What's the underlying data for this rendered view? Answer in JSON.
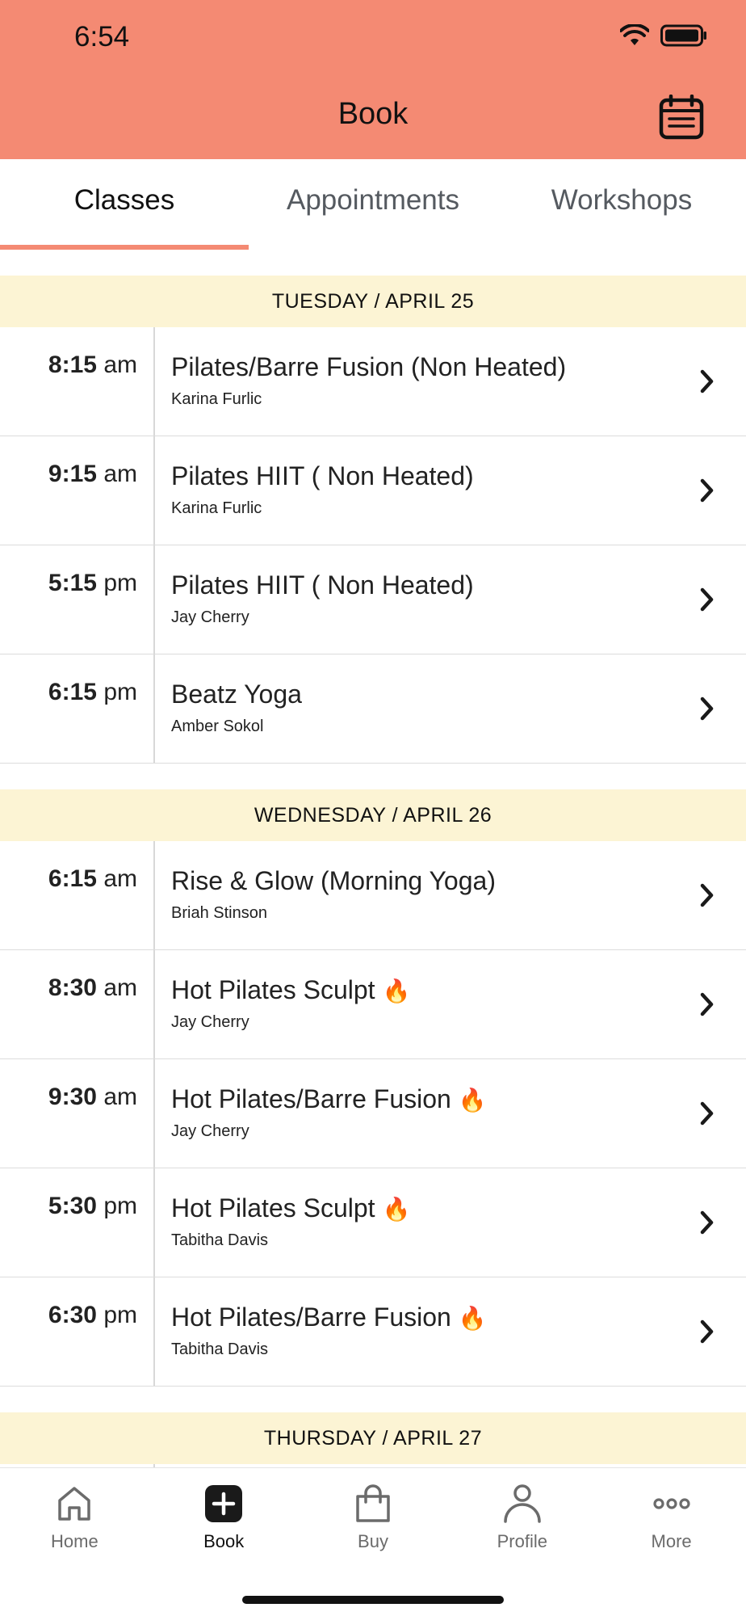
{
  "status_bar": {
    "time": "6:54"
  },
  "header": {
    "title": "Book",
    "calendar_icon": "calendar-icon",
    "background": "#f48a73"
  },
  "tabs": [
    {
      "label": "Classes",
      "active": true
    },
    {
      "label": "Appointments",
      "active": false
    },
    {
      "label": "Workshops",
      "active": false
    }
  ],
  "days": [
    {
      "label": "TUESDAY / APRIL 25",
      "classes": [
        {
          "time": "8:15",
          "ampm": "am",
          "name": "Pilates/Barre Fusion (Non Heated)",
          "instructor": "Karina Furlic",
          "heated": false
        },
        {
          "time": "9:15",
          "ampm": "am",
          "name": "Pilates HIIT ( Non Heated)",
          "instructor": "Karina Furlic",
          "heated": false
        },
        {
          "time": "5:15",
          "ampm": "pm",
          "name": "Pilates HIIT ( Non Heated)",
          "instructor": "Jay Cherry",
          "heated": false
        },
        {
          "time": "6:15",
          "ampm": "pm",
          "name": "Beatz Yoga",
          "instructor": "Amber Sokol",
          "heated": false
        }
      ]
    },
    {
      "label": "WEDNESDAY / APRIL 26",
      "classes": [
        {
          "time": "6:15",
          "ampm": "am",
          "name": "Rise & Glow (Morning Yoga)",
          "instructor": "Briah Stinson",
          "heated": false
        },
        {
          "time": "8:30",
          "ampm": "am",
          "name": "Hot Pilates Sculpt",
          "instructor": "Jay Cherry",
          "heated": true
        },
        {
          "time": "9:30",
          "ampm": "am",
          "name": "Hot Pilates/Barre Fusion",
          "instructor": "Jay Cherry",
          "heated": true
        },
        {
          "time": "5:30",
          "ampm": "pm",
          "name": "Hot Pilates Sculpt",
          "instructor": "Tabitha Davis",
          "heated": true
        },
        {
          "time": "6:30",
          "ampm": "pm",
          "name": "Hot Pilates/Barre Fusion",
          "instructor": "Tabitha Davis",
          "heated": true
        }
      ]
    },
    {
      "label": "THURSDAY / APRIL 27",
      "classes": []
    }
  ],
  "flame_glyph": "🔥",
  "bottom_nav": [
    {
      "label": "Home",
      "icon": "home-icon",
      "active": false
    },
    {
      "label": "Book",
      "icon": "plus-square-icon",
      "active": true
    },
    {
      "label": "Buy",
      "icon": "shopping-bag-icon",
      "active": false
    },
    {
      "label": "Profile",
      "icon": "person-icon",
      "active": false
    },
    {
      "label": "More",
      "icon": "more-dots-icon",
      "active": false
    }
  ]
}
